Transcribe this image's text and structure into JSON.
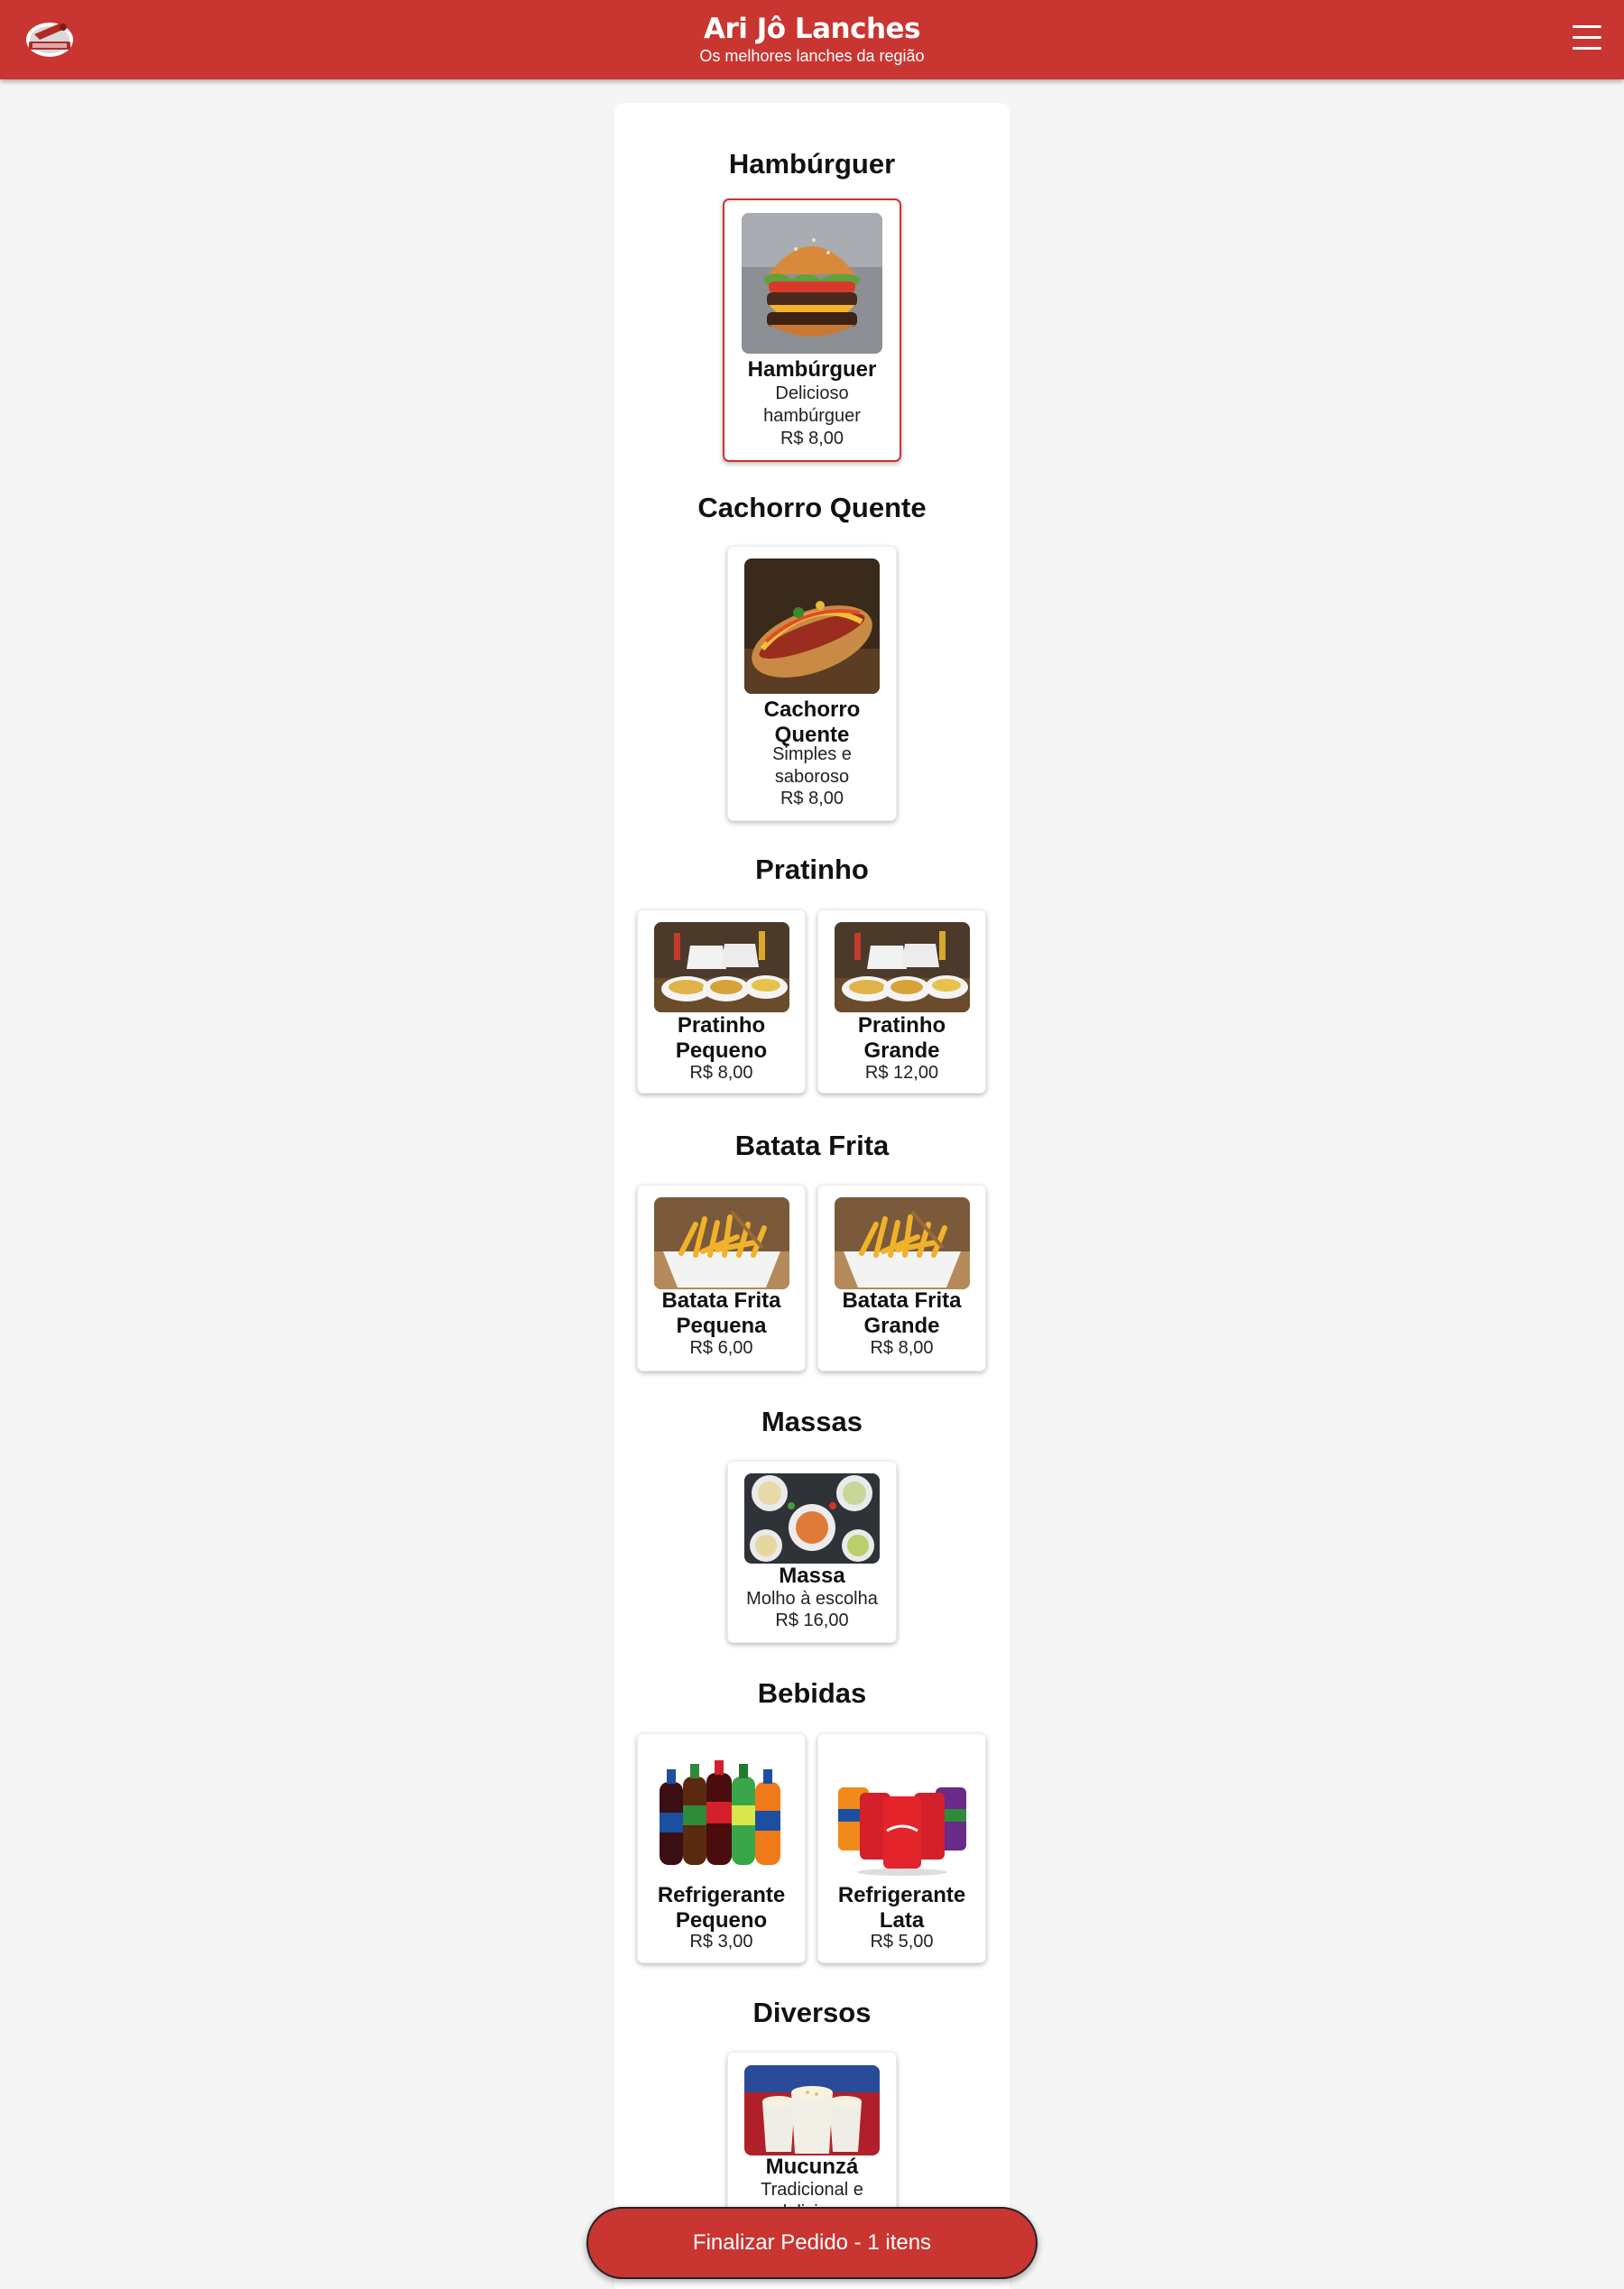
{
  "header": {
    "title": "Ari Jô Lanches",
    "subtitle": "Os melhores lanches da região"
  },
  "sections": [
    {
      "title": "Hambúrguer",
      "items": [
        {
          "name": "Hambúrguer",
          "desc": "Delicioso hambúrguer",
          "price": "R$ 8,00",
          "selected": true
        }
      ]
    },
    {
      "title": "Cachorro Quente",
      "items": [
        {
          "name": "Cachorro Quente",
          "desc": "Simples e saboroso",
          "price": "R$ 8,00"
        }
      ]
    },
    {
      "title": "Pratinho",
      "items": [
        {
          "name": "Pratinho Pequeno",
          "price": "R$ 8,00"
        },
        {
          "name": "Pratinho Grande",
          "price": "R$ 12,00"
        }
      ]
    },
    {
      "title": "Batata Frita",
      "items": [
        {
          "name": "Batata Frita Pequena",
          "price": "R$ 6,00"
        },
        {
          "name": "Batata Frita Grande",
          "price": "R$ 8,00"
        }
      ]
    },
    {
      "title": "Massas",
      "items": [
        {
          "name": "Massa",
          "desc": "Molho à escolha",
          "price": "R$ 16,00"
        }
      ]
    },
    {
      "title": "Bebidas",
      "items": [
        {
          "name": "Refrigerante Pequeno",
          "price": "R$ 3,00"
        },
        {
          "name": "Refrigerante Lata",
          "price": "R$ 5,00"
        }
      ]
    },
    {
      "title": "Diversos",
      "items": [
        {
          "name": "Mucunzá",
          "desc": "Tradicional e delicioso"
        }
      ]
    }
  ],
  "footer": {
    "finalize_label": "Finalizar Pedido - 1 itens"
  },
  "colors": {
    "brand": "#c93530",
    "background": "#f5f5f5"
  },
  "icons": [
    "logo-icon",
    "menu-icon"
  ]
}
